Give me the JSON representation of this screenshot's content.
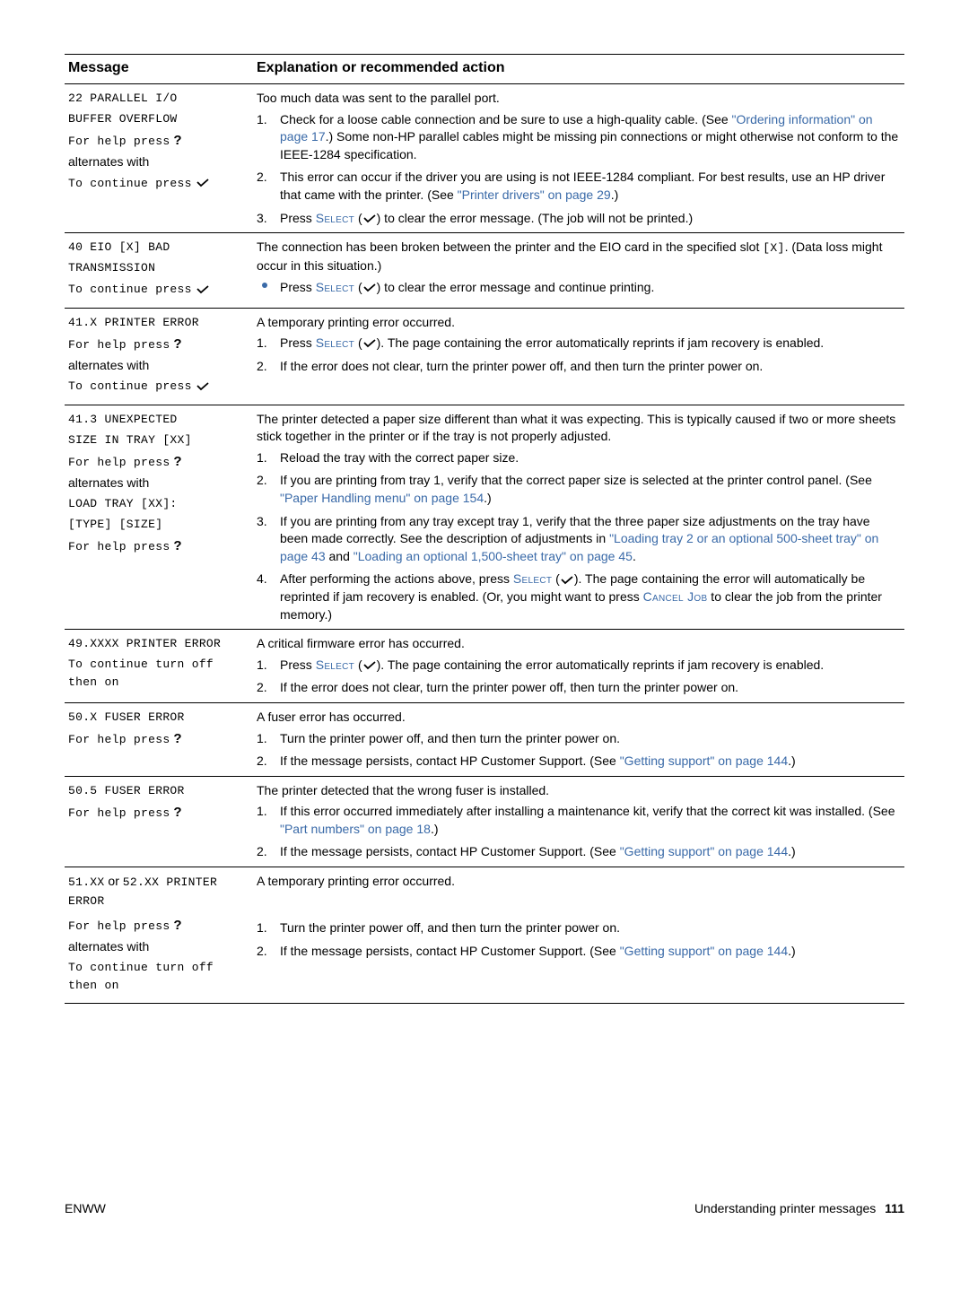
{
  "header": {
    "col_message": "Message",
    "col_explanation": "Explanation or recommended action"
  },
  "glyphs": {
    "qmark": "?",
    "check": "✓",
    "bracket_x": "[X]"
  },
  "links": {
    "ordering_info": "\"Ordering information\" on page 17",
    "printer_drivers": "\"Printer drivers\" on page 29",
    "paper_handling": "\"Paper Handling menu\" on page 154",
    "loading_tray2": "\"Loading tray 2 or an optional 500-sheet tray\" on page 43",
    "loading_1500": "\"Loading an optional 1,500-sheet tray\" on page 45",
    "getting_support": "\"Getting support\" on page 144",
    "part_numbers": "\"Part numbers\" on page 18"
  },
  "terms": {
    "select": "Select",
    "cancel_job": "Cancel Job"
  },
  "rows": [
    {
      "id": "r22",
      "msg": {
        "line1": "22 PARALLEL I/O",
        "line2": "BUFFER OVERFLOW",
        "line3_a": "For help press",
        "alt": "alternates with",
        "line4_a": "To continue press"
      },
      "exp": {
        "lead": "Too much data was sent to the parallel port.",
        "s1a": "Check for a loose cable connection and be sure to use a high-quality cable. (See ",
        "s1b": ".) Some non-HP parallel cables might be missing pin connections or might otherwise not conform to the IEEE-1284 specification.",
        "s2a": "This error can occur if the driver you are using is not IEEE-1284 compliant. For best results, use an HP driver that came with the printer. (See ",
        "s2b": ".)",
        "s3a": "Press ",
        "s3b": " to clear the error message. (The job will not be printed.)"
      }
    },
    {
      "id": "r40",
      "msg": {
        "line1": "40 EIO [X] BAD",
        "line2": "TRANSMISSION",
        "line3_a": "To continue press"
      },
      "exp": {
        "lead_a": "The connection has been broken between the printer and the EIO card in the specified slot ",
        "lead_b": ". (Data loss might occur in this situation.)",
        "b1a": "Press ",
        "b1b": " to clear the error message and continue printing."
      }
    },
    {
      "id": "r41x",
      "msg": {
        "line1": "41.X PRINTER ERROR",
        "line2_a": "For help press",
        "alt": "alternates with",
        "line3_a": "To continue press"
      },
      "exp": {
        "lead": "A temporary printing error occurred.",
        "s1a": "Press ",
        "s1b": ". The page containing the error automatically reprints if jam recovery is enabled.",
        "s2": "If the error does not clear, turn the printer power off, and then turn the printer power on."
      }
    },
    {
      "id": "r413",
      "msg": {
        "line1": "41.3 UNEXPECTED",
        "line2": "SIZE IN TRAY [XX]",
        "line3_a": "For help press",
        "alt": "alternates with",
        "line4": "LOAD TRAY [XX]:",
        "line5": "[TYPE] [SIZE]",
        "line6_a": "For help press"
      },
      "exp": {
        "lead": "The printer detected a paper size different than what it was expecting. This is typically caused if two or more sheets stick together in the printer or if the tray is not properly adjusted.",
        "s1": "Reload the tray with the correct paper size.",
        "s2a": "If you are printing from tray 1, verify that the correct paper size is selected at the printer control panel. (See ",
        "s2b": ".)",
        "s3a": "If you are printing from any tray except tray 1, verify that the three paper size adjustments on the tray have been made correctly. See the description of adjustments in ",
        "s3b": " and ",
        "s3c": ".",
        "s4a": "After performing the actions above, press ",
        "s4b": ". The page containing the error will automatically be reprinted if jam recovery is enabled. (Or, you might want to press ",
        "s4c": " to clear the job from the printer memory.)"
      }
    },
    {
      "id": "r49",
      "msg": {
        "line1": "49.XXXX PRINTER ERROR",
        "line2": "To continue turn off then on"
      },
      "exp": {
        "lead": "A critical firmware error has occurred.",
        "s1a": "Press ",
        "s1b": ". The page containing the error automatically reprints if jam recovery is enabled.",
        "s2": "If the error does not clear, turn the printer power off, then turn the printer power on."
      }
    },
    {
      "id": "r50x",
      "msg": {
        "line1": "50.X FUSER ERROR",
        "line2_a": "For help press"
      },
      "exp": {
        "lead": "A fuser error has occurred.",
        "s1": "Turn the printer power off, and then turn the printer power on.",
        "s2a": "If the message persists, contact HP Customer Support. (See ",
        "s2b": ".)"
      }
    },
    {
      "id": "r505",
      "msg": {
        "line1": "50.5 FUSER ERROR",
        "line2_a": "For help press"
      },
      "exp": {
        "lead": "The printer detected that the wrong fuser is installed.",
        "s1a": "If this error occurred immediately after installing a maintenance kit, verify that the correct kit was installed. (See ",
        "s1b": ".)",
        "s2a": "If the message persists, contact HP Customer Support. (See ",
        "s2b": ".)"
      }
    },
    {
      "id": "r51",
      "msg": {
        "line1a": "51.XX",
        "line1_or": " or ",
        "line1b": "52.XX PRINTER ERROR",
        "line2_a": "For help press",
        "alt": "alternates with",
        "line3": "To continue turn off then on"
      },
      "exp": {
        "lead": "A temporary printing error occurred.",
        "s1": "Turn the printer power off, and then turn the printer power on.",
        "s2a": "If the message persists, contact HP Customer Support. (See ",
        "s2b": ".)"
      }
    }
  ],
  "footer": {
    "left": "ENWW",
    "right_label": "Understanding printer messages",
    "page": "111"
  }
}
